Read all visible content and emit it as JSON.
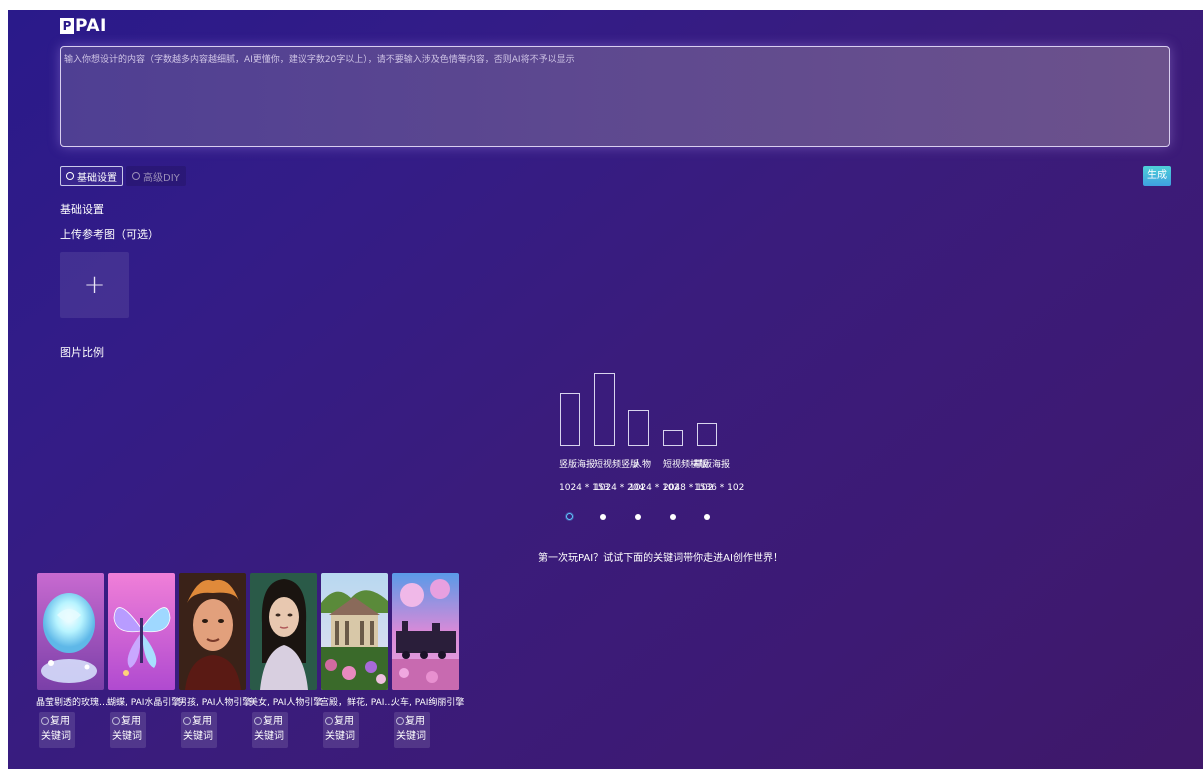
{
  "app": {
    "logo_mark": "P",
    "logo_text": "PAI"
  },
  "prompt": {
    "placeholder": "输入你想设计的内容（字数越多内容越细腻，AI更懂你，建议字数20字以上），请不要输入涉及色情等内容，否则AI将不予以显示"
  },
  "mode_tabs": [
    {
      "label": "基础设置",
      "active": true
    },
    {
      "label": "高级DIY",
      "active": false
    }
  ],
  "generate_label": "生成",
  "settings": {
    "section_title": "基础设置",
    "upload_label": "上传参考图（可选）",
    "upload_icon": "plus-icon",
    "ratio_label": "图片比例"
  },
  "ratios": [
    {
      "name": "竖版海报",
      "size": "1024 * 1536",
      "selected": true
    },
    {
      "name": "短视频竖版",
      "size": "1024 * 2048",
      "selected": false
    },
    {
      "name": "人物",
      "size": "1024 * 1024",
      "selected": false
    },
    {
      "name": "短视频横版",
      "size": "2048 * 1024",
      "selected": false
    },
    {
      "name": "横版海报",
      "size": "1536 * 1024",
      "selected": false
    }
  ],
  "ratio_display_names": [
    "竖版海报",
    "短视频竖版",
    "人物",
    "短视频横版",
    "横版海报"
  ],
  "ratio_display_sizes": [
    "1024 * 153",
    "1024 * 204",
    "1024 * 102",
    "2048 * 102",
    "1536 * 102"
  ],
  "hint": "第一次玩PAI？试试下面的关键词带你走进AI创作世界！",
  "examples": [
    {
      "caption": "晶莹剔透的玫瑰花...",
      "button": "复用关键词"
    },
    {
      "caption": "蝴蝶, PAI水晶引擎",
      "button": "复用关键词"
    },
    {
      "caption": "男孩, PAI人物引擎",
      "button": "复用关键词"
    },
    {
      "caption": "美女, PAI人物引擎",
      "button": "复用关键词"
    },
    {
      "caption": "宫殿，鲜花, PAI绚...",
      "button": "复用关键词"
    },
    {
      "caption": "火车, PAI绚丽引擎",
      "button": "复用关键词"
    }
  ],
  "colors": {
    "background_start": "#2a1a8a",
    "background_end": "#3f1869",
    "generate_button": "#3f9fe0",
    "selected_radio": "#5fc8ff"
  }
}
